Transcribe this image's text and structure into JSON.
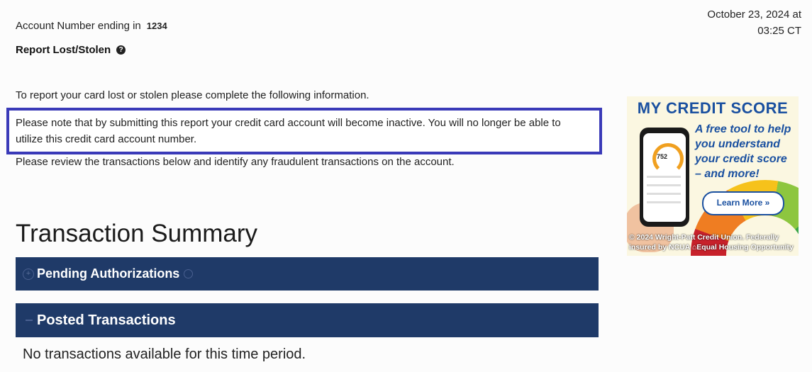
{
  "account": {
    "label": "Account Number ending in",
    "number": "1234"
  },
  "datetime": {
    "date": "October 23, 2024 at",
    "time": "03:25 CT"
  },
  "report": {
    "title": "Report Lost/Stolen",
    "help_icon": "question-circle-icon"
  },
  "instructions": {
    "intro": "To report your card lost or stolen please complete the following information.",
    "notice": "Please note that by submitting this report your credit card account will become inactive. You will no longer be able to utilize this credit card account number.",
    "review": "Please review the transactions below and identify any fraudulent transactions on the account."
  },
  "summary": {
    "title": "Transaction Summary",
    "pending_label": "Pending Authorizations",
    "posted_label": "Posted Transactions",
    "empty_message": "No transactions available for this time period."
  },
  "ad": {
    "title": "MY CREDIT SCORE",
    "tagline": "A free tool to help you understand your credit score – and more!",
    "phone_score": "752",
    "button_label": "Learn More »",
    "footer": "© 2024 Wright-Patt Credit Union. Federally insured by NCUA  ⌂Equal Housing Opportunity"
  },
  "colors": {
    "bar_bg": "#1f3a68",
    "notice_border": "#3a3ab8",
    "ad_blue": "#1a50a0"
  }
}
